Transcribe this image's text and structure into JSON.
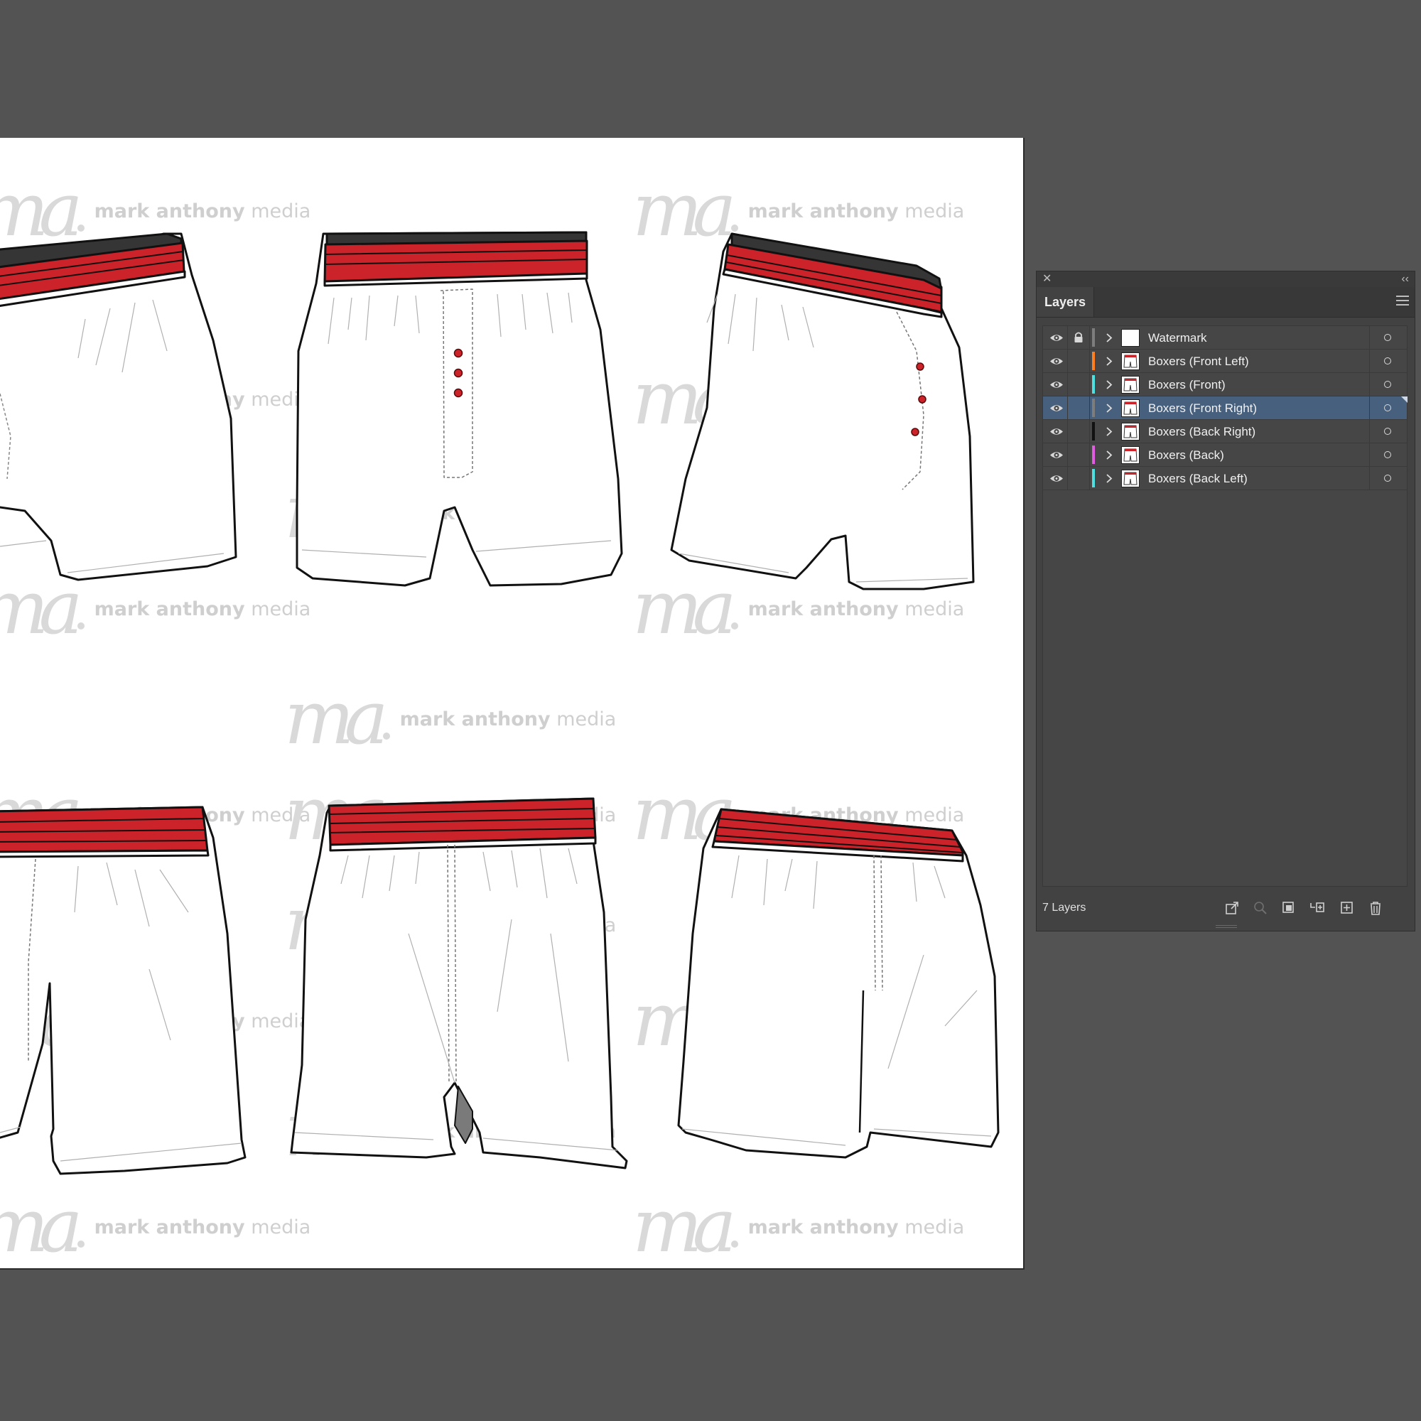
{
  "panel": {
    "tab_label": "Layers",
    "footer_count": "7 Layers",
    "layers": [
      {
        "name": "Watermark",
        "color": "#7d7d7d",
        "visible": true,
        "locked": true,
        "selected": false
      },
      {
        "name": "Boxers (Front Left)",
        "color": "#ff7f1f",
        "visible": true,
        "locked": false,
        "selected": false
      },
      {
        "name": "Boxers (Front)",
        "color": "#4ee0e0",
        "visible": true,
        "locked": false,
        "selected": false
      },
      {
        "name": "Boxers (Front Right)",
        "color": "#7d7d7d",
        "visible": true,
        "locked": false,
        "selected": true
      },
      {
        "name": "Boxers (Back Right)",
        "color": "#111111",
        "visible": true,
        "locked": false,
        "selected": false
      },
      {
        "name": "Boxers (Back)",
        "color": "#e05ce0",
        "visible": true,
        "locked": false,
        "selected": false
      },
      {
        "name": "Boxers (Back Left)",
        "color": "#4ee0e0",
        "visible": true,
        "locked": false,
        "selected": false
      }
    ],
    "footer_icons": [
      "export-icon",
      "locate-object-icon",
      "make-clipping-mask-icon",
      "new-sublayer-icon",
      "new-layer-icon",
      "delete-icon"
    ]
  },
  "artboard": {
    "watermark_logo": "ma",
    "watermark_brand": "mark anthony",
    "watermark_suffix": "media",
    "band_color": "#cc2229",
    "dark_band_color": "#353535",
    "garments": [
      {
        "layer": "Boxers (Front Left)"
      },
      {
        "layer": "Boxers (Front)"
      },
      {
        "layer": "Boxers (Front Right)"
      },
      {
        "layer": "Boxers (Back Left)"
      },
      {
        "layer": "Boxers (Back)"
      },
      {
        "layer": "Boxers (Back Right)"
      }
    ]
  }
}
